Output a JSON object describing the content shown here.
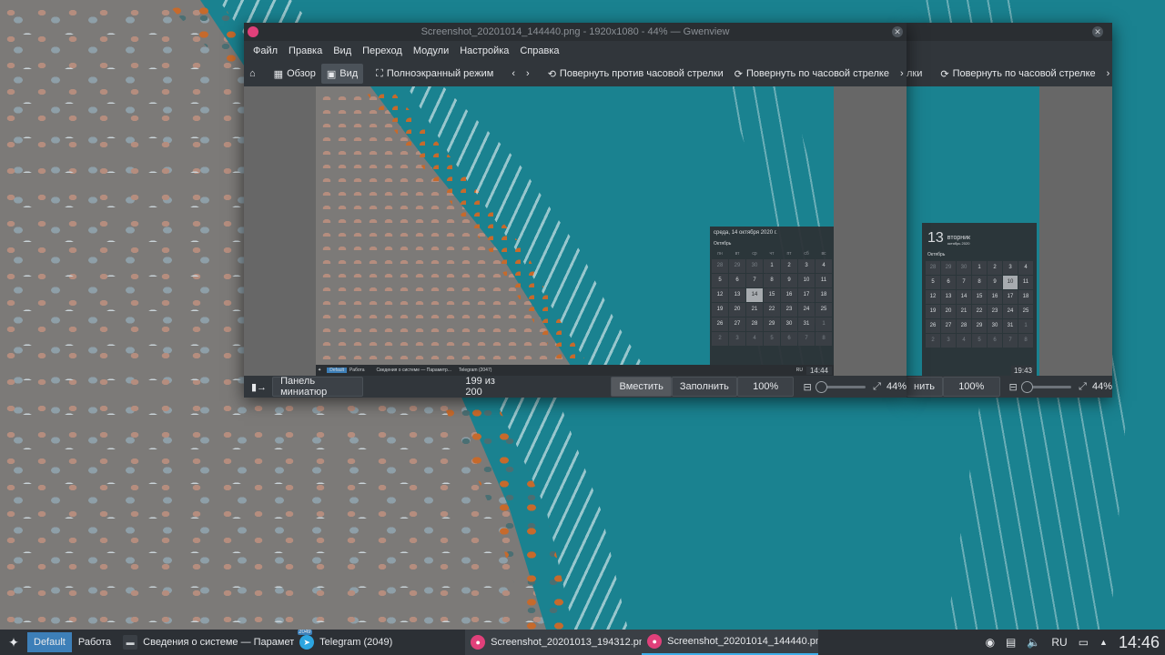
{
  "back_window": {
    "toolbar": {
      "rotate_ccw_partial": "лки",
      "rotate_cw": "Повернуть по часовой стрелке"
    },
    "status": {
      "fill_partial": "нить",
      "zoom_100": "100%",
      "zoom_value": "44%"
    },
    "inner_calendar": {
      "day_number": "13",
      "weekday": "вторник",
      "month_year": "октябрь 2020",
      "month": "Октябрь",
      "clock": "19:43",
      "days": [
        "28",
        "29",
        "30",
        "1",
        "2",
        "3",
        "4",
        "5",
        "6",
        "7",
        "8",
        "9",
        "10",
        "11",
        "12",
        "13",
        "14",
        "15",
        "16",
        "17",
        "18",
        "19",
        "20",
        "21",
        "22",
        "23",
        "24",
        "25",
        "26",
        "27",
        "28",
        "29",
        "30",
        "31",
        "1",
        "2",
        "3",
        "4",
        "5",
        "6",
        "7",
        "8"
      ],
      "today_index": 12
    }
  },
  "main_window": {
    "title": "Screenshot_20201014_144440.png - 1920x1080 - 44% — Gwenview",
    "menu": [
      "Файл",
      "Правка",
      "Вид",
      "Переход",
      "Модули",
      "Настройка",
      "Справка"
    ],
    "toolbar": {
      "overview": "Обзор",
      "view": "Вид",
      "fullscreen": "Полноэкранный режим",
      "rotate_ccw": "Повернуть против часовой стрелки",
      "rotate_cw": "Повернуть по часовой стрелке"
    },
    "status": {
      "thumbnail_panel": "Панель миниатюр",
      "counter": "199 из 200",
      "fit": "Вместить",
      "fill": "Заполнить",
      "zoom_100": "100%",
      "zoom_value": "44%"
    },
    "inner_calendar": {
      "header": "среда, 14 октября 2020 г.",
      "month": "Октябрь",
      "weekdays": [
        "пн",
        "вт",
        "ср",
        "чт",
        "пт",
        "сб",
        "вс"
      ],
      "days": [
        "28",
        "29",
        "30",
        "1",
        "2",
        "3",
        "4",
        "5",
        "6",
        "7",
        "8",
        "9",
        "10",
        "11",
        "12",
        "13",
        "14",
        "15",
        "16",
        "17",
        "18",
        "19",
        "20",
        "21",
        "22",
        "23",
        "24",
        "25",
        "26",
        "27",
        "28",
        "29",
        "30",
        "31",
        "1",
        "2",
        "3",
        "4",
        "5",
        "6",
        "7",
        "8"
      ],
      "today_index": 16,
      "clock": "14:44"
    },
    "inner_taskbar": {
      "desktop1": "Default",
      "desktop2": "Работа",
      "task1": "Сведения о системе — Параметр...",
      "task2": "Telegram (2047)",
      "lang": "RU"
    }
  },
  "taskbar": {
    "desktops": [
      "Default",
      "Работа"
    ],
    "current_desktop_index": 0,
    "tasks": [
      {
        "label": "Сведения о системе — Параметр...",
        "icon": "monitor-icon"
      },
      {
        "label": "Telegram (2049)",
        "icon": "telegram-icon",
        "badge": "2049"
      },
      {
        "label": "Screenshot_20201013_194312.png ...",
        "icon": "gwenview-icon"
      },
      {
        "label": "Screenshot_20201014_144440.png ...",
        "icon": "gwenview-icon"
      }
    ],
    "tray": {
      "lang": "RU"
    },
    "clock": "14:46"
  },
  "colors": {
    "accent": "#3daee9",
    "window_bg": "#31363b",
    "taskbar_bg": "#2c3035",
    "sea": "#1a8290"
  }
}
